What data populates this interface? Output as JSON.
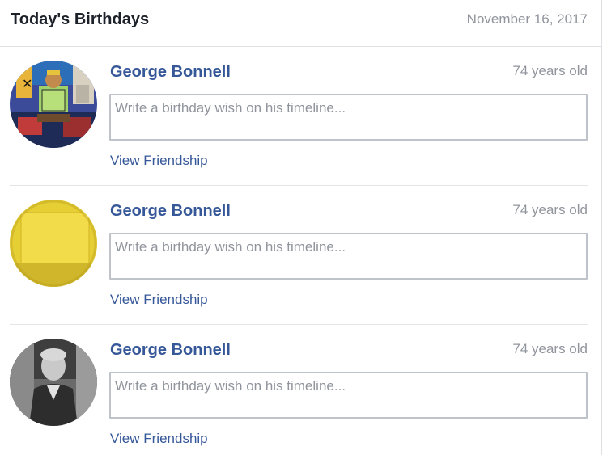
{
  "header": {
    "title": "Today's Birthdays",
    "date": "November 16, 2017"
  },
  "birthdays": [
    {
      "name": "George Bonnell",
      "age": "74 years old",
      "wish_placeholder": "Write a birthday wish on his timeline...",
      "friendship_link": "View Friendship"
    },
    {
      "name": "George Bonnell",
      "age": "74 years old",
      "wish_placeholder": "Write a birthday wish on his timeline...",
      "friendship_link": "View Friendship"
    },
    {
      "name": "George Bonnell",
      "age": "74 years old",
      "wish_placeholder": "Write a birthday wish on his timeline...",
      "friendship_link": "View Friendship"
    }
  ],
  "colors": {
    "link": "#365899",
    "muted": "#90949c",
    "border": "#dddfe2"
  }
}
